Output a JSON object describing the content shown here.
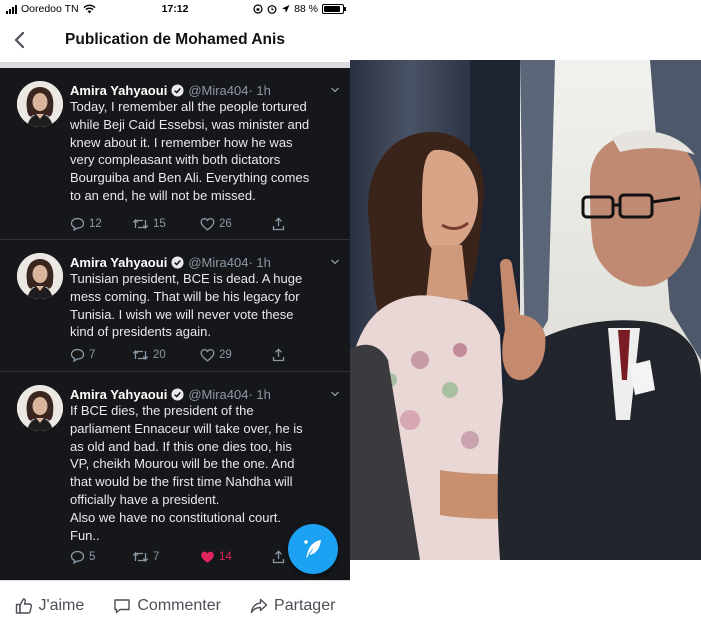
{
  "status_bar": {
    "carrier": "Ooredoo TN",
    "time": "17:12",
    "battery": "88 %",
    "battery_level": 0.88
  },
  "navbar": {
    "title": "Publication de Mohamed Anis",
    "back_icon": "chevron-left-icon"
  },
  "tweets": [
    {
      "name": "Amira Yahyaoui",
      "handle": "@Mira404",
      "time": "· 1h",
      "text": "Today, I remember all the people tortured\nwhile Beji Caid Essebsi, was minister and\nknew about it. I remember how he was\nvery compleasant with both dictators\nBourguiba and Ben Ali. Everything comes\nto an end, he will not be missed.",
      "replies": "12",
      "retweets": "15",
      "likes": "26",
      "liked": false
    },
    {
      "name": "Amira Yahyaoui",
      "handle": "@Mira404",
      "time": "· 1h",
      "text": "Tunisian president, BCE is dead. A huge\nmess coming. That will be his legacy for\nTunisia. I wish we will never vote these\nkind of presidents again.",
      "replies": "7",
      "retweets": "20",
      "likes": "29",
      "liked": false
    },
    {
      "name": "Amira Yahyaoui",
      "handle": "@Mira404",
      "time": "· 1h",
      "text": "If BCE dies, the president of the\nparliament Ennaceur will take over, he is\nas old and bad. If this one dies too, his\nVP, cheikh Mourou will be the one. And\nthat would be the first time Nahdha will\nofficially have a president.\nAlso we have no constitutional court.\nFun..",
      "replies": "5",
      "retweets": "7",
      "likes": "14",
      "liked": true
    }
  ],
  "fab_icon": "compose-feather-icon",
  "facebook_bar": {
    "like": "J'aime",
    "comment": "Commenter",
    "share": "Partager"
  },
  "colors": {
    "twitter_blue": "#1da1f2",
    "timeline_bg": "#15171a",
    "like_red": "#e0245e",
    "muted": "#8b98a5"
  }
}
